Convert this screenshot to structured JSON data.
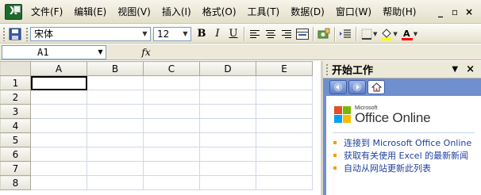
{
  "app": {
    "icon_letter": "X"
  },
  "menu": {
    "items": [
      {
        "label": "文件(F)"
      },
      {
        "label": "编辑(E)"
      },
      {
        "label": "视图(V)"
      },
      {
        "label": "插入(I)"
      },
      {
        "label": "格式(O)"
      },
      {
        "label": "工具(T)"
      },
      {
        "label": "数据(D)"
      },
      {
        "label": "窗口(W)"
      },
      {
        "label": "帮助(H)"
      }
    ],
    "minimize_glyph": "_",
    "restore_glyph": "▫",
    "close_glyph": "×"
  },
  "toolbar": {
    "font_name": "宋体",
    "font_size": "12",
    "bold_label": "B",
    "italic_label": "I",
    "underline_label": "U"
  },
  "formula_bar": {
    "name_box": "A1",
    "fx_label": "fx"
  },
  "grid": {
    "columns": [
      "A",
      "B",
      "C",
      "D",
      "E"
    ],
    "rows": [
      "1",
      "2",
      "3",
      "4",
      "5",
      "6",
      "7",
      "8"
    ]
  },
  "task_pane": {
    "title": "开始工作",
    "logo_small": "Microsoft",
    "logo_text": "Office Online",
    "links": [
      {
        "text": "连接到 Microsoft Office Online"
      },
      {
        "text": "获取有关使用 Excel 的最新新闻"
      },
      {
        "text": "自动从网站更新此列表"
      }
    ]
  },
  "colors": {
    "accent": "#316ac5",
    "excel_green": "#1d6b2c",
    "taskpane_blue": "#6f8fcf",
    "link_blue": "#1f3f9f",
    "bullet_orange": "#ff9900"
  }
}
